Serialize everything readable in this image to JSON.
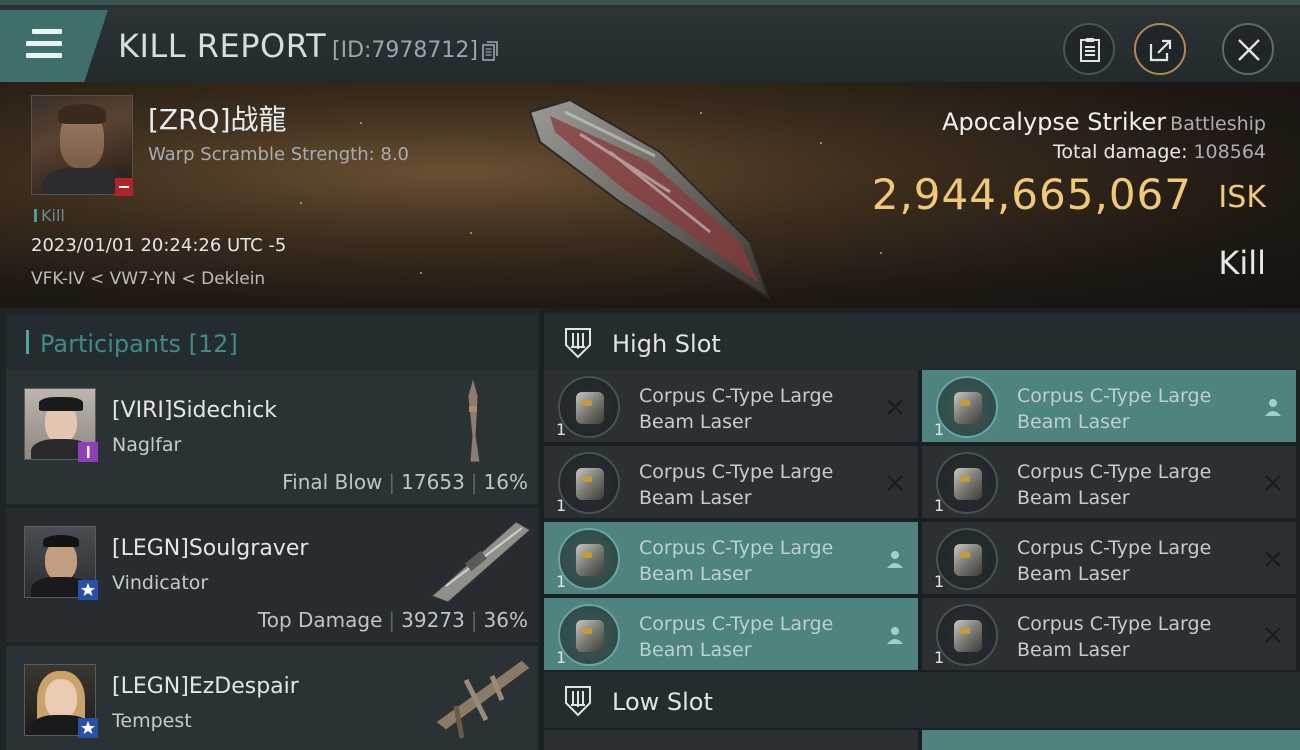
{
  "header": {
    "title": "KILL REPORT",
    "report_id": "[ID:7978712]"
  },
  "victim": {
    "name": "[ZRQ]战龍",
    "warp_scramble": "Warp Scramble Strength: 8.0",
    "kill_tag": "Kill",
    "datetime": "2023/01/01 20:24:26 UTC -5",
    "location": "VFK-IV < VW7-YN < Deklein",
    "ship_name": "Apocalypse Striker",
    "ship_class": "Battleship",
    "total_damage_label": "Total damage:",
    "total_damage_value": "108564",
    "isk_value": "2,944,665,067",
    "isk_label": "ISK",
    "result": "Kill"
  },
  "participants": {
    "label": "Participants",
    "count": "[12]",
    "rows": [
      {
        "name": "[VIRI]Sidechick",
        "ship": "Naglfar",
        "stat_label": "Final Blow",
        "damage": "17653",
        "percent": "16%"
      },
      {
        "name": "[LEGN]Soulgraver",
        "ship": "Vindicator",
        "stat_label": "Top Damage",
        "damage": "39273",
        "percent": "36%"
      },
      {
        "name": "[LEGN]EzDespair",
        "ship": "Tempest"
      }
    ]
  },
  "slots": {
    "high_label": "High Slot",
    "low_label": "Low Slot",
    "high_modules": [
      {
        "name": "Corpus C-Type Large Beam Laser",
        "qty": "1",
        "state": "destroyed"
      },
      {
        "name": "Corpus C-Type Large Beam Laser",
        "qty": "1",
        "state": "dropped"
      },
      {
        "name": "Corpus C-Type Large Beam Laser",
        "qty": "1",
        "state": "destroyed"
      },
      {
        "name": "Corpus C-Type Large Beam Laser",
        "qty": "1",
        "state": "destroyed"
      },
      {
        "name": "Corpus C-Type Large Beam Laser",
        "qty": "1",
        "state": "dropped"
      },
      {
        "name": "Corpus C-Type Large Beam Laser",
        "qty": "1",
        "state": "destroyed"
      },
      {
        "name": "Corpus C-Type Large Beam Laser",
        "qty": "1",
        "state": "dropped"
      },
      {
        "name": "Corpus C-Type Large Beam Laser",
        "qty": "1",
        "state": "destroyed"
      }
    ]
  },
  "colors": {
    "accent_teal": "#4f837f",
    "isk_gold": "#f0c878",
    "victim_badge_red": "#b0232a"
  }
}
